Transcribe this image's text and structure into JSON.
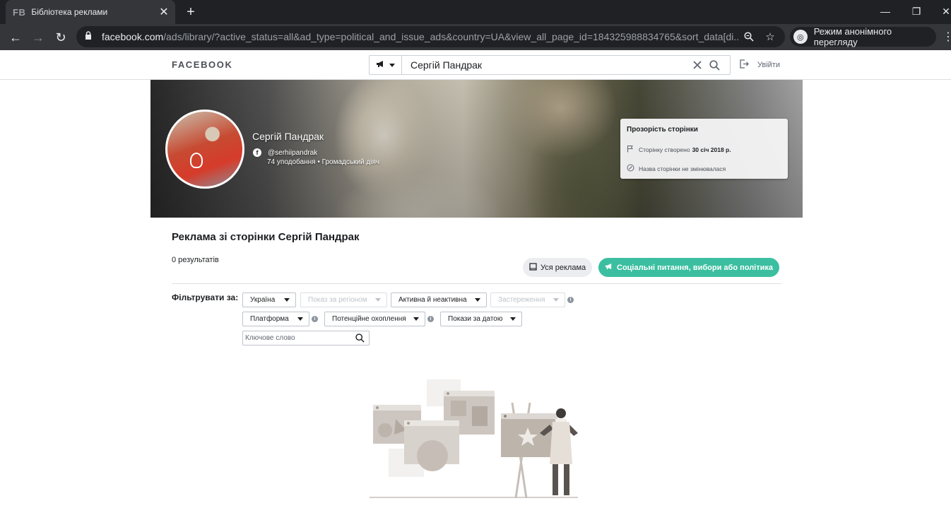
{
  "browser": {
    "tab_favicon": "FB",
    "tab_title": "Бібліотека реклами",
    "url_host": "facebook.com",
    "url_rest": "/ads/library/?active_status=all&ad_type=political_and_issue_ads&country=UA&view_all_page_id=184325988834765&sort_data[di...",
    "incognito_label": "Режим анонімного перегляду"
  },
  "header": {
    "logo": "FACEBOOK",
    "search_value": "Сергій Пандрак",
    "logout_label": "Увійти"
  },
  "page": {
    "name": "Сергій Пандрак",
    "handle": "@serhiipandrak",
    "meta": "74 уподобання • Громадський діяч"
  },
  "transparency": {
    "title": "Прозорість сторінки",
    "created_prefix": "Сторінку створено",
    "created_date": "30 січ 2018 р.",
    "name_unchanged": "Назва сторінки не змінювалася"
  },
  "content": {
    "title": "Реклама зі сторінки Сергій Пандрак",
    "results": "0 результатів",
    "btn_all": "Уся реклама",
    "btn_social": "Соціальні питання, вибори або політика"
  },
  "filters": {
    "label": "Фільтрувати за:",
    "country": "Україна",
    "region": "Показ за регіоном",
    "status": "Активна й неактивна",
    "disclaimer": "Застереження",
    "platform": "Платформа",
    "reach": "Потенційне охоплення",
    "date": "Покази за датою",
    "keyword_placeholder": "Ключове слово"
  },
  "colors": {
    "accent": "#3bbfa0",
    "chrome_dark": "#202124",
    "chrome_toolbar": "#35363a"
  },
  "icons": [
    "back-arrow-icon",
    "forward-arrow-icon",
    "reload-icon",
    "lock-icon",
    "zoom-icon",
    "star-icon",
    "incognito-icon",
    "megaphone-icon",
    "clear-icon",
    "search-icon",
    "logout-icon",
    "facebook-icon",
    "flag-icon",
    "edit-icon",
    "book-icon",
    "info-icon"
  ]
}
